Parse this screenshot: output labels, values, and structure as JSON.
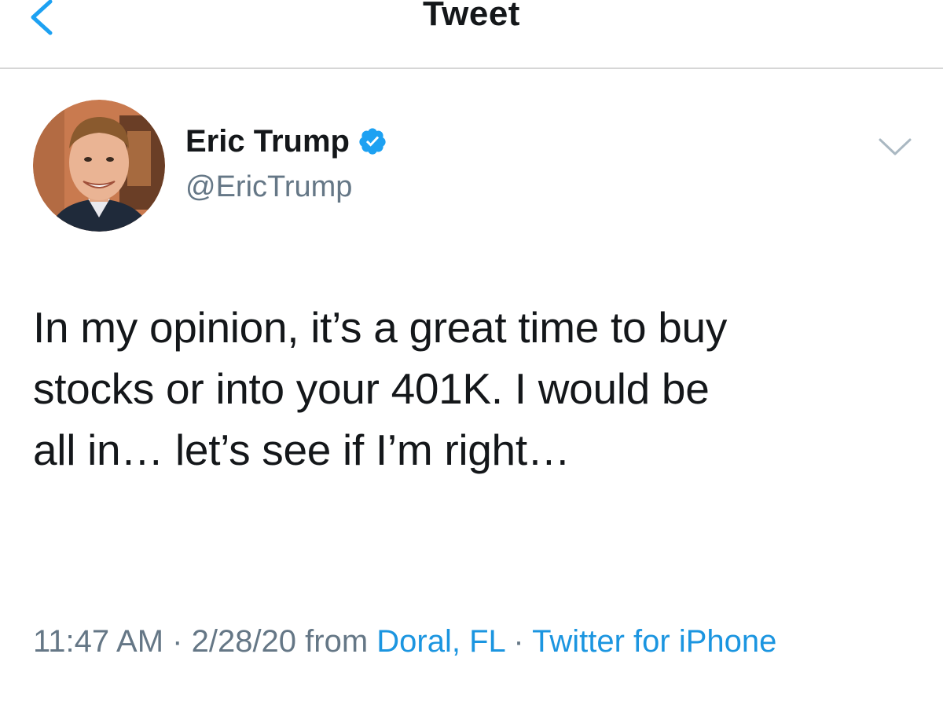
{
  "nav": {
    "title": "Tweet",
    "back_icon": "chevron-left-icon",
    "accent": "#1da1f2"
  },
  "tweet": {
    "author": {
      "display_name": "Eric Trump",
      "handle": "@EricTrump",
      "verified": true,
      "verified_badge_color": "#1da1f2"
    },
    "text_lines": [
      "In my opinion, it’s a great time to buy",
      "stocks or into your 401K. I would be",
      "all in… let’s see if I’m right…"
    ],
    "meta": {
      "time": "11:47 AM",
      "separator": " · ",
      "date": "2/28/20",
      "from_label": " from ",
      "location": "Doral, FL",
      "source": "Twitter for iPhone"
    },
    "caret_icon": "chevron-down-icon"
  },
  "colors": {
    "text": "#14171a",
    "secondary": "#657786",
    "link": "#1b95e0",
    "divider": "#d6d6d6"
  }
}
